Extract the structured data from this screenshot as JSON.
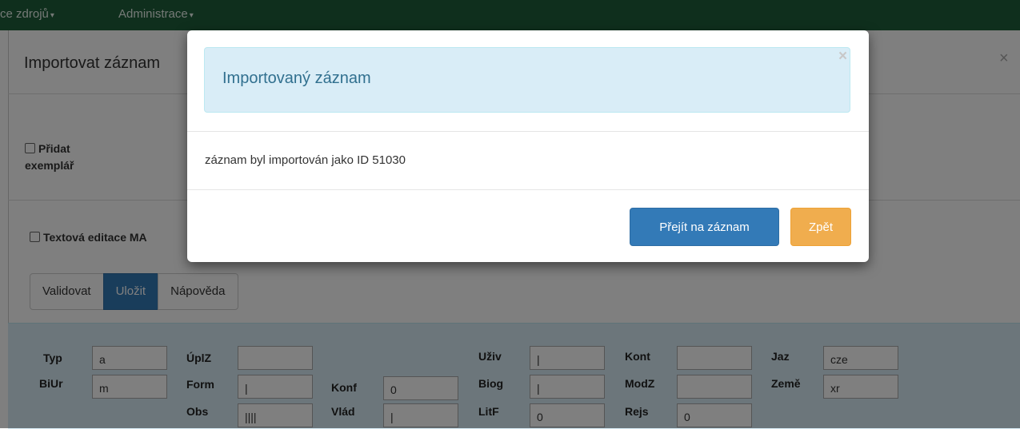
{
  "navbar": {
    "item1": "ce zdrojů",
    "item2": "Administrace",
    "caret": "▾"
  },
  "background_dialog": {
    "title": "Importovat záznam",
    "close": "×",
    "add_copy": "Přidat exemplář",
    "add_copy_line1": "Přidat",
    "add_copy_line2": "exemplář",
    "text_edit": "Textová editace MA",
    "buttons": {
      "validate": "Validovat",
      "save": "Uložit",
      "help": "Nápověda"
    }
  },
  "fixed_fields": [
    {
      "label": "Typ",
      "value": "a"
    },
    {
      "label": "BiUr",
      "value": "m"
    },
    {
      "label": "ÚplZ",
      "value": ""
    },
    {
      "label": "Form",
      "value": "|"
    },
    {
      "label": "Obs",
      "value": "||||"
    },
    {
      "label": "Konf",
      "value": "0"
    },
    {
      "label": "Vlád",
      "value": "|"
    },
    {
      "label": "Uživ",
      "value": "|"
    },
    {
      "label": "Biog",
      "value": "|"
    },
    {
      "label": "LitF",
      "value": "0"
    },
    {
      "label": "Kont",
      "value": ""
    },
    {
      "label": "ModZ",
      "value": ""
    },
    {
      "label": "Rejs",
      "value": "0"
    },
    {
      "label": "Jaz",
      "value": "cze"
    },
    {
      "label": "Země",
      "value": "xr"
    }
  ],
  "modal": {
    "title": "Importovaný záznam",
    "close": "×",
    "message": "záznam byl importován jako ID 51030",
    "go_button": "Přejít na záznam",
    "back_button": "Zpět"
  },
  "colors": {
    "navbar": "#1f5f3a",
    "primary": "#337ab7",
    "warning": "#f0ad4e",
    "info_bg": "#d9edf7",
    "info_text": "#31708f"
  }
}
